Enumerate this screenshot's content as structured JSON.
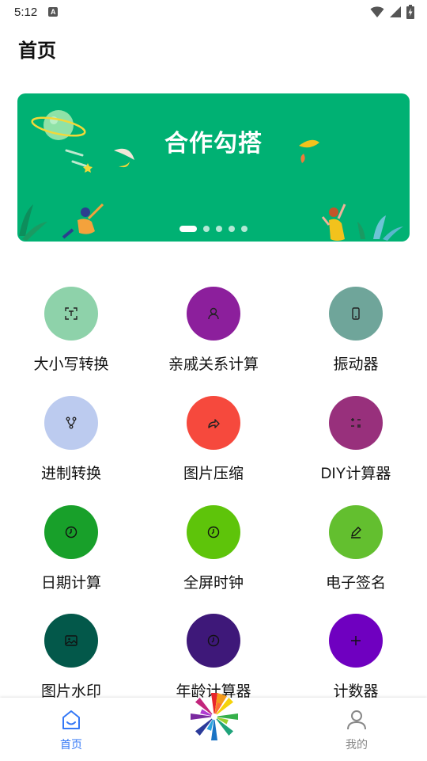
{
  "status_bar": {
    "time": "5:12",
    "notification_letter": "A"
  },
  "page": {
    "title": "首页"
  },
  "banner": {
    "title": "合作勾搭",
    "background": "#00b173",
    "dot_count": 5,
    "active_index": 0
  },
  "tools": [
    {
      "label": "大小写转换",
      "color": "#8ed2aa",
      "icon": "text-case-icon"
    },
    {
      "label": "亲戚关系计算",
      "color": "#8c1f9c",
      "icon": "person-icon"
    },
    {
      "label": "振动器",
      "color": "#6fa59a",
      "icon": "phone-icon"
    },
    {
      "label": "进制转换",
      "color": "#bccbef",
      "icon": "branch-icon"
    },
    {
      "label": "图片压缩",
      "color": "#f6493d",
      "icon": "share-arrow-icon"
    },
    {
      "label": "DIY计算器",
      "color": "#98307c",
      "icon": "calculator-icon"
    },
    {
      "label": "日期计算",
      "color": "#18a02a",
      "icon": "clock-icon"
    },
    {
      "label": "全屏时钟",
      "color": "#5ec40a",
      "icon": "clock-icon"
    },
    {
      "label": "电子签名",
      "color": "#63bf2f",
      "icon": "pen-icon"
    },
    {
      "label": "图片水印",
      "color": "#03584a",
      "icon": "image-icon"
    },
    {
      "label": "年龄计算器",
      "color": "#3e1879",
      "icon": "clock-icon"
    },
    {
      "label": "计数器",
      "color": "#6f00c0",
      "icon": "plus-icon"
    }
  ],
  "tabbar": {
    "home_label": "首页",
    "mine_label": "我的",
    "active_color": "#3478f6",
    "inactive_color": "#888888"
  }
}
